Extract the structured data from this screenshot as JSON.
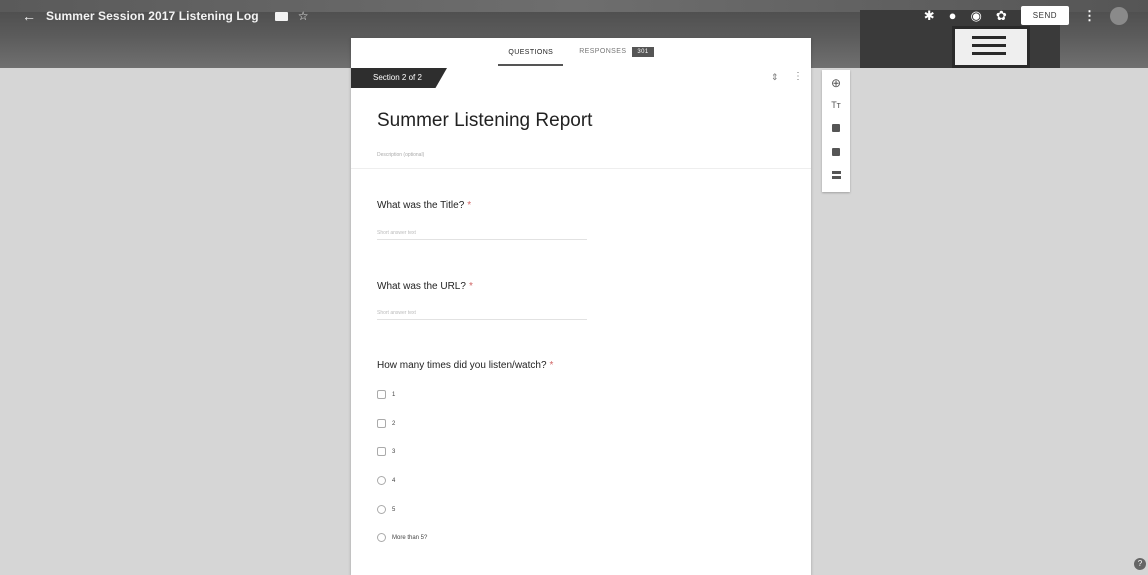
{
  "header": {
    "title": "Summer Session 2017 Listening Log",
    "send_label": "SEND",
    "icons": [
      "back-arrow-icon",
      "folder-icon",
      "star-icon",
      "puzzle-icon",
      "palette-icon",
      "eye-icon",
      "gear-icon",
      "more-vert-icon"
    ]
  },
  "tabs": {
    "questions": "QUESTIONS",
    "responses": "RESPONSES",
    "responses_count": "301"
  },
  "section": {
    "tag": "Section 2 of 2",
    "title": "Summer Listening Report",
    "description_placeholder": "Description (optional)"
  },
  "questions": [
    {
      "title": "What was the Title?",
      "required": "*",
      "answer_placeholder": "Short answer text"
    },
    {
      "title": "What was the URL?",
      "required": "*",
      "answer_placeholder": "Short answer text"
    },
    {
      "title": "How many times did you listen/watch?",
      "required": "*"
    }
  ],
  "options": [
    "1",
    "2",
    "3",
    "4",
    "5",
    "More than 5?"
  ],
  "side_toolbar": {
    "text_label": "Tт",
    "tools": [
      "add-question-icon",
      "title-text-icon",
      "image-icon",
      "video-icon",
      "section-icon"
    ]
  },
  "colors": {
    "header_dark": "#4a4a4a",
    "section_tag": "#2e2e2e",
    "required_mark": "#d06565",
    "page_bg": "#d6d6d6"
  }
}
